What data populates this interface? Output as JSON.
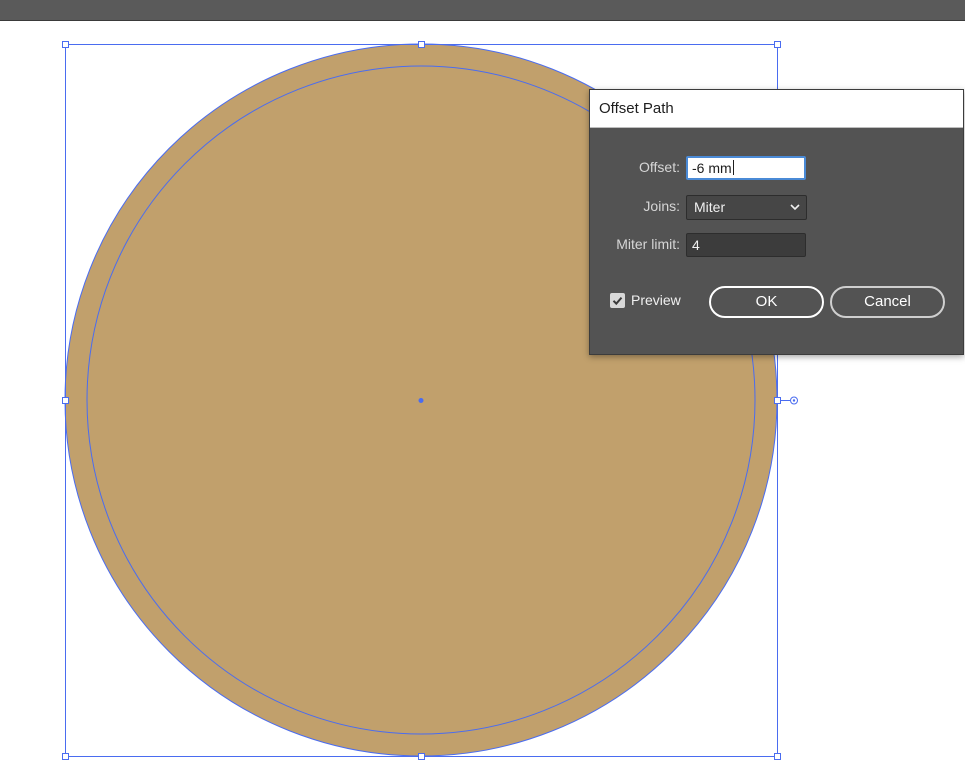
{
  "colors": {
    "fill": "#c1a06c",
    "path_stroke": "#4a6cf0",
    "dialog_bg": "#535353",
    "topbar": "#5a5a5a"
  },
  "dialog": {
    "title": "Offset Path",
    "offset_label": "Offset:",
    "offset_value": "-6 mm",
    "joins_label": "Joins:",
    "joins_value": "Miter",
    "miter_label": "Miter limit:",
    "miter_value": "4",
    "preview_label": "Preview",
    "preview_checked": true,
    "ok_label": "OK",
    "cancel_label": "Cancel"
  },
  "icons": {
    "preview_checkbox": "check-icon",
    "joins_dropdown": "chevron-down-icon"
  }
}
